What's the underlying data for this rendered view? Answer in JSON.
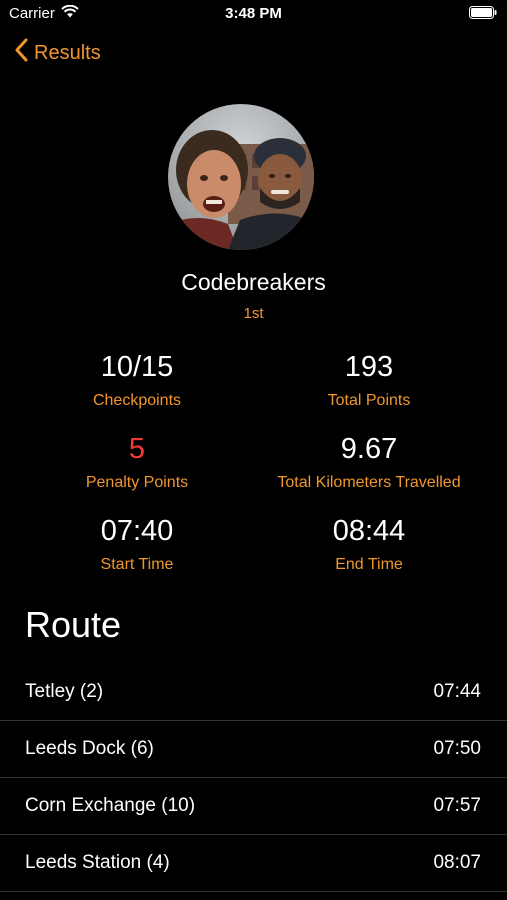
{
  "status": {
    "carrier": "Carrier",
    "time": "3:48 PM"
  },
  "nav": {
    "back_label": "Results"
  },
  "team": {
    "name": "Codebreakers",
    "rank": "1st"
  },
  "stats": {
    "checkpoints": {
      "value": "10/15",
      "label": "Checkpoints"
    },
    "total_points": {
      "value": "193",
      "label": "Total Points"
    },
    "penalty_points": {
      "value": "5",
      "label": "Penalty Points"
    },
    "distance": {
      "value": "9.67",
      "label": "Total Kilometers Travelled"
    },
    "start_time": {
      "value": "07:40",
      "label": "Start Time"
    },
    "end_time": {
      "value": "08:44",
      "label": "End Time"
    }
  },
  "route": {
    "title": "Route",
    "items": [
      {
        "name": "Tetley (2)",
        "time": "07:44"
      },
      {
        "name": "Leeds Dock (6)",
        "time": "07:50"
      },
      {
        "name": "Corn Exchange (10)",
        "time": "07:57"
      },
      {
        "name": "Leeds Station (4)",
        "time": "08:07"
      }
    ]
  },
  "colors": {
    "accent": "#f0962e",
    "penalty": "#f23c33",
    "background": "#000000"
  }
}
